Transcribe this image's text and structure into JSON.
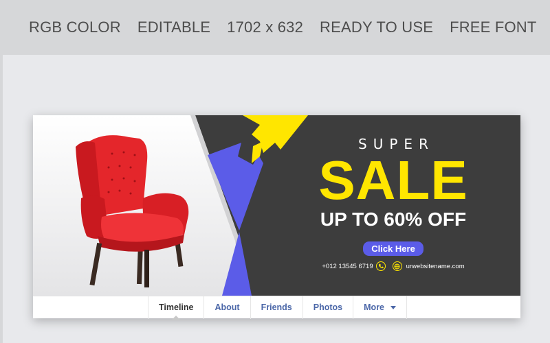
{
  "features": [
    "RGB COLOR",
    "EDITABLE",
    "1702 x 632",
    "READY TO USE",
    "FREE FONT"
  ],
  "promo": {
    "super": "SUPER",
    "sale": "SALE",
    "offer": "UP TO 60% OFF",
    "cta": "Click Here",
    "phone": "+012 13545 6719",
    "website": "urwebsitename.com"
  },
  "tabs": {
    "timeline": "Timeline",
    "about": "About",
    "friends": "Friends",
    "photos": "Photos",
    "more": "More"
  },
  "colors": {
    "dark": "#3d3d3d",
    "yellow": "#ffe600",
    "purple": "#5b5ce8",
    "chair": "#e8262b"
  },
  "icons": [
    "phone-icon",
    "globe-icon",
    "chevron-down-icon"
  ]
}
